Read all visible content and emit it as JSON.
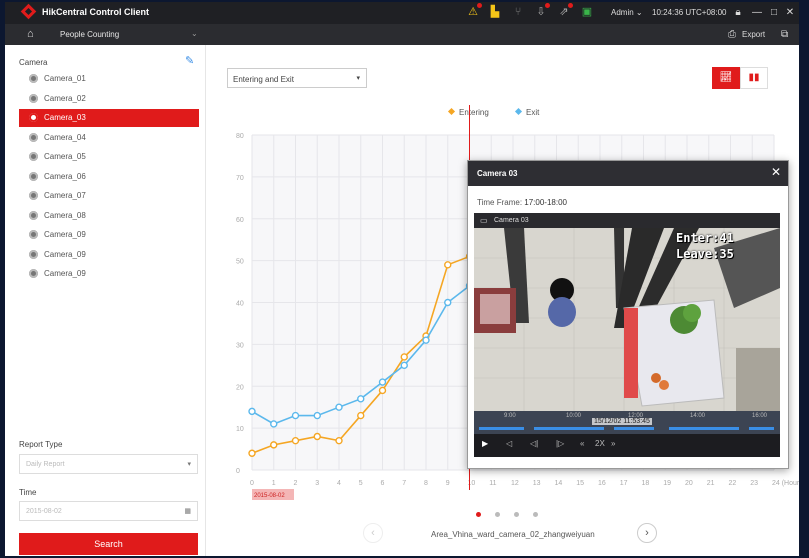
{
  "app": {
    "title": "HikCentral Control Client",
    "user": "Admin",
    "clock": "10:24:36 UTC+08:00",
    "module_tab": "People Counting",
    "export_label": "Export"
  },
  "sidebar": {
    "title": "Camera",
    "cameras": [
      "Camera_01",
      "Camera_02",
      "Camera_03",
      "Camera_04",
      "Camera_05",
      "Camera_06",
      "Camera_07",
      "Camera_08",
      "Camera_09",
      "Camera_09",
      "Camera_09"
    ],
    "selected_index": 2,
    "report_type_label": "Report Type",
    "report_type_value": "Daily Report",
    "time_label": "Time",
    "time_value": "2015-08-02",
    "search_label": "Search"
  },
  "main": {
    "mode_select": "Entering and Exit",
    "legend": [
      {
        "name": "Entering",
        "color": "#f5a623"
      },
      {
        "name": "Exit",
        "color": "#5bb8ec"
      }
    ],
    "area_name": "Area_Vhina_ward_camera_02_zhangweiyuan",
    "active_page": 0,
    "page_count": 4
  },
  "chart_data": {
    "type": "line",
    "x": [
      0,
      1,
      2,
      3,
      4,
      5,
      6,
      7,
      8,
      9,
      10
    ],
    "x_ticks": [
      "0",
      "1",
      "2",
      "3",
      "4",
      "5",
      "6",
      "7",
      "8",
      "9",
      "10",
      "11",
      "12",
      "13",
      "14",
      "15",
      "16",
      "17",
      "18",
      "19",
      "20",
      "21",
      "22",
      "23",
      "24 (Hour)"
    ],
    "y_ticks": [
      "0",
      "10",
      "20",
      "30",
      "40",
      "50",
      "60",
      "70",
      "80"
    ],
    "ylim": [
      0,
      80
    ],
    "xlim": [
      0,
      24
    ],
    "series": [
      {
        "name": "Entering",
        "color": "#f5a623",
        "values": [
          4,
          6,
          7,
          8,
          7,
          13,
          19,
          27,
          32,
          49,
          51
        ]
      },
      {
        "name": "Exit",
        "color": "#5bb8ec",
        "values": [
          14,
          11,
          13,
          13,
          15,
          17,
          21,
          25,
          31,
          40,
          44
        ]
      }
    ],
    "cursor_x": 10,
    "cursor_label": "2015-08-02"
  },
  "popup": {
    "title": "Camera 03",
    "time_frame_label": "Time Frame:",
    "time_frame_value": "17:00-18:00",
    "video_name": "Camera 03",
    "enter_text": "Enter:41",
    "leave_text": "Leave:35",
    "timestamp": "15/12/02 11:53:45",
    "timeline_ticks": [
      "9:00",
      "10:00",
      "12:00",
      "14:00",
      "16:00"
    ],
    "speed": "2X"
  }
}
